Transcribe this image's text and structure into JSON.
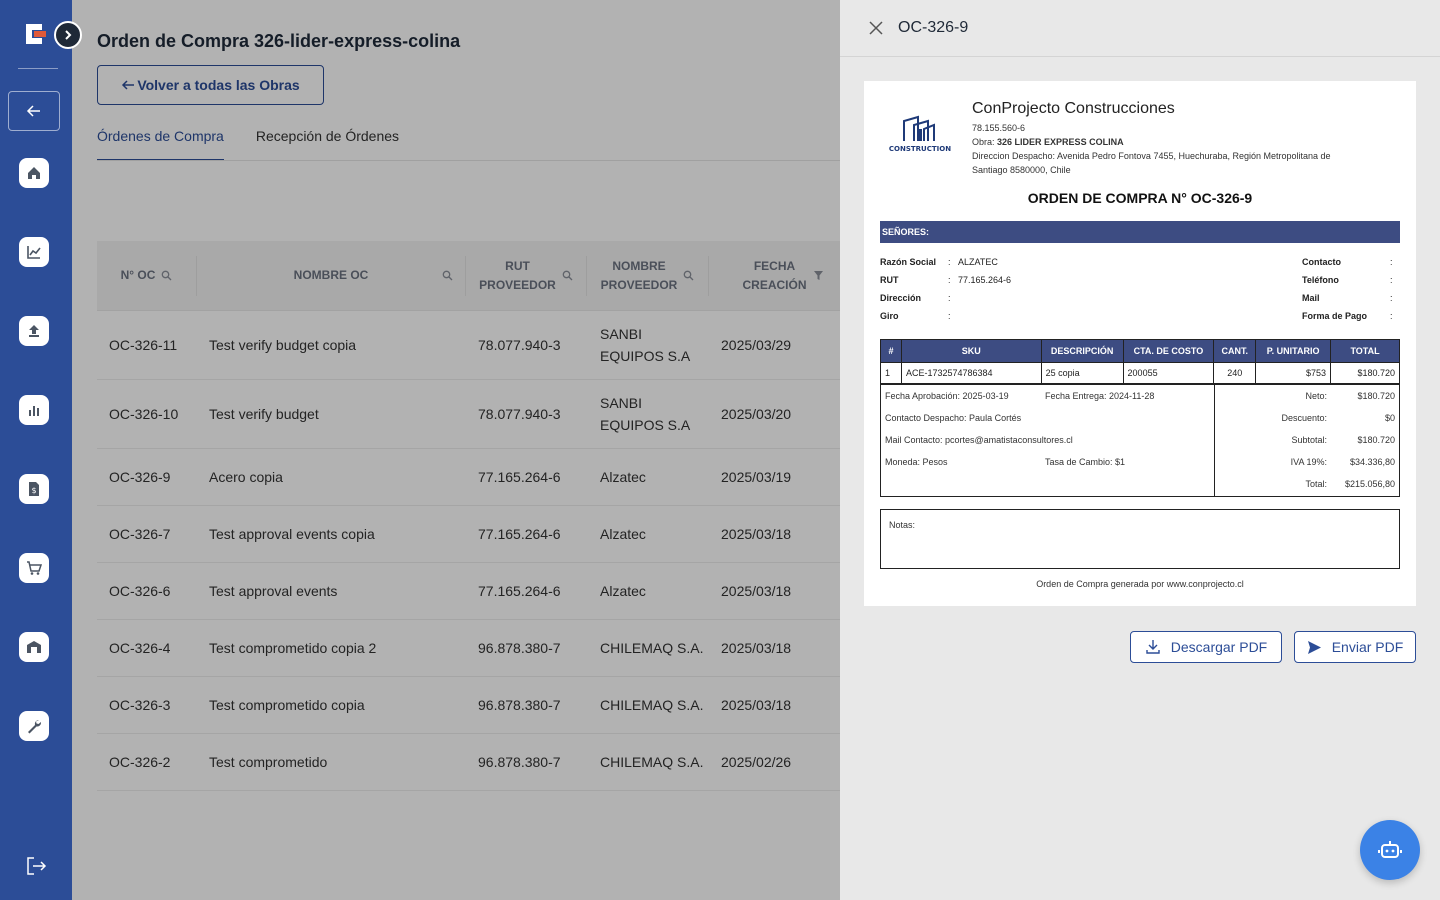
{
  "main": {
    "title": "Orden de Compra 326-lider-express-colina",
    "return_label": "Volver a todas las Obras",
    "tabs": [
      "Órdenes de Compra",
      "Recepción de Órdenes"
    ],
    "columns": [
      {
        "line1": "N° OC",
        "line2": ""
      },
      {
        "line1": "NOMBRE OC",
        "line2": ""
      },
      {
        "line1": "RUT",
        "line2": "PROVEEDOR"
      },
      {
        "line1": "NOMBRE",
        "line2": "PROVEEDOR"
      },
      {
        "line1": "FECHA",
        "line2": "CREACIÓN"
      }
    ],
    "rows": [
      {
        "oc": "OC-326-11",
        "name": "Test verify budget copia",
        "rut": "78.077.940-3",
        "prov1": "SANBI",
        "prov2": "EQUIPOS S.A",
        "date": "2025/03/29"
      },
      {
        "oc": "OC-326-10",
        "name": "Test verify budget",
        "rut": "78.077.940-3",
        "prov1": "SANBI",
        "prov2": "EQUIPOS S.A",
        "date": "2025/03/20"
      },
      {
        "oc": "OC-326-9",
        "name": "Acero copia",
        "rut": "77.165.264-6",
        "prov1": "Alzatec",
        "prov2": "",
        "date": "2025/03/19"
      },
      {
        "oc": "OC-326-7",
        "name": "Test approval events copia",
        "rut": "77.165.264-6",
        "prov1": "Alzatec",
        "prov2": "",
        "date": "2025/03/18"
      },
      {
        "oc": "OC-326-6",
        "name": "Test approval events",
        "rut": "77.165.264-6",
        "prov1": "Alzatec",
        "prov2": "",
        "date": "2025/03/18"
      },
      {
        "oc": "OC-326-4",
        "name": "Test comprometido copia 2",
        "rut": "96.878.380-7",
        "prov1": "CHILEMAQ S.A.",
        "prov2": "",
        "date": "2025/03/18"
      },
      {
        "oc": "OC-326-3",
        "name": "Test comprometido copia",
        "rut": "96.878.380-7",
        "prov1": "CHILEMAQ S.A.",
        "prov2": "",
        "date": "2025/03/18"
      },
      {
        "oc": "OC-326-2",
        "name": "Test comprometido",
        "rut": "96.878.380-7",
        "prov1": "CHILEMAQ S.A.",
        "prov2": "",
        "date": "2025/02/26"
      }
    ]
  },
  "drawer": {
    "title": "OC-326-9",
    "download_label": "Descargar PDF",
    "send_label": "Enviar PDF"
  },
  "doc": {
    "logo_text": "CONSTRUCTION",
    "company": "ConProjecto Construcciones",
    "rut": "78.155.560-6",
    "obra_label": "Obra:",
    "obra_value": "326 LIDER EXPRESS COLINA",
    "direccion_line1": "Direccion Despacho: Avenida Pedro Fontova 7455, Huechuraba, Región Metropolitana de",
    "direccion_line2": "Santiago 8580000, Chile",
    "title": "ORDEN DE COMPRA N° OC-326-9",
    "senores": "SEÑORES:",
    "left_fields": [
      {
        "label": "Razón Social",
        "value": "ALZATEC"
      },
      {
        "label": "RUT",
        "value": "77.165.264-6"
      },
      {
        "label": "Dirección",
        "value": ""
      },
      {
        "label": "Giro",
        "value": ""
      }
    ],
    "right_fields": [
      {
        "label": "Contacto",
        "value": ""
      },
      {
        "label": "Teléfono",
        "value": ""
      },
      {
        "label": "Mail",
        "value": ""
      },
      {
        "label": "Forma de Pago",
        "value": ""
      }
    ],
    "colon": ":",
    "item_headers": [
      "#",
      "SKU",
      "DESCRIPCIÓN",
      "CTA. DE COSTO",
      "CANT.",
      "P. UNITARIO",
      "TOTAL"
    ],
    "item": {
      "n": "1",
      "sku": "ACE-1732574786384",
      "desc": "25 copia",
      "cta": "200055",
      "cant": "240",
      "unit": "$753",
      "total": "$180.720"
    },
    "fecha_aprobacion": "Fecha Aprobación: 2025-03-19",
    "fecha_entrega": "Fecha Entrega: 2024-11-28",
    "contacto_despacho": "Contacto Despacho: Paula Cortés",
    "mail_contacto": "Mail Contacto: pcortes@amatistaconsultores.cl",
    "moneda": "Moneda: Pesos",
    "tasa": "Tasa de Cambio: $1",
    "totals": [
      {
        "label": "Neto:",
        "value": "$180.720"
      },
      {
        "label": "Descuento:",
        "value": "$0"
      },
      {
        "label": "Subtotal:",
        "value": "$180.720"
      },
      {
        "label": "IVA 19%:",
        "value": "$34.336,80"
      },
      {
        "label": "Total:",
        "value": "$215.056,80"
      }
    ],
    "notas": "Notas:",
    "footer": "Orden de Compra generada por www.conprojecto.cl"
  },
  "colors": {
    "sidebar": "#2c4d97",
    "doc_header": "#3d4c82",
    "fab": "#3b82e6"
  }
}
